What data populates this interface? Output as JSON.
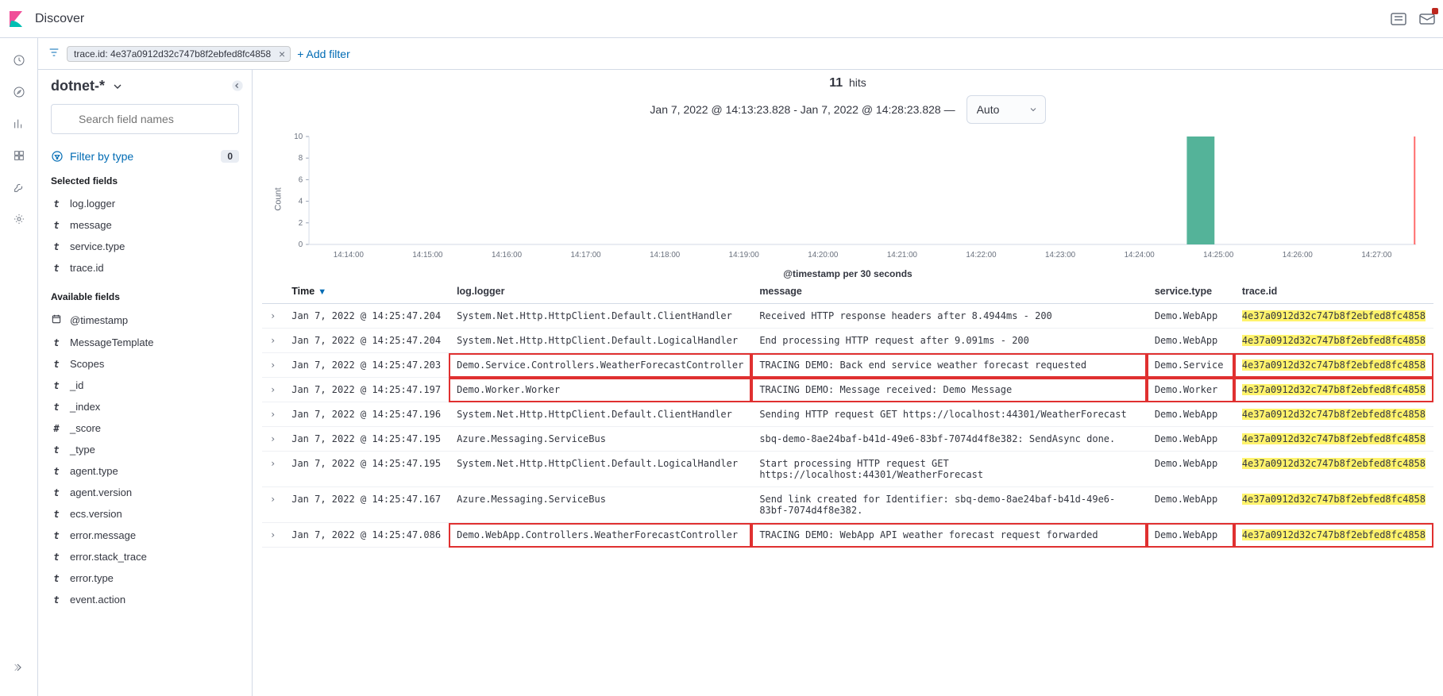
{
  "header": {
    "title": "Discover"
  },
  "filter_bar": {
    "pill": "trace.id: 4e37a0912d32c747b8f2ebfed8fc4858",
    "add_filter": "+ Add filter"
  },
  "side": {
    "index_pattern": "dotnet-*",
    "search_placeholder": "Search field names",
    "filter_by_type": "Filter by type",
    "filter_count": "0",
    "selected_label": "Selected fields",
    "available_label": "Available fields",
    "selected_fields": [
      {
        "type": "t",
        "name": "log.logger"
      },
      {
        "type": "t",
        "name": "message"
      },
      {
        "type": "t",
        "name": "service.type"
      },
      {
        "type": "t",
        "name": "trace.id"
      }
    ],
    "available_fields": [
      {
        "type": "date",
        "name": "@timestamp"
      },
      {
        "type": "t",
        "name": "MessageTemplate"
      },
      {
        "type": "t",
        "name": "Scopes"
      },
      {
        "type": "t",
        "name": "_id"
      },
      {
        "type": "t",
        "name": "_index"
      },
      {
        "type": "num",
        "name": "_score"
      },
      {
        "type": "t",
        "name": "_type"
      },
      {
        "type": "t",
        "name": "agent.type"
      },
      {
        "type": "t",
        "name": "agent.version"
      },
      {
        "type": "t",
        "name": "ecs.version"
      },
      {
        "type": "t",
        "name": "error.message"
      },
      {
        "type": "t",
        "name": "error.stack_trace"
      },
      {
        "type": "t",
        "name": "error.type"
      },
      {
        "type": "t",
        "name": "event.action"
      }
    ]
  },
  "hits": {
    "count": "11",
    "label": "hits",
    "range": "Jan 7, 2022 @ 14:13:23.828 - Jan 7, 2022 @ 14:28:23.828 —",
    "interval": "Auto",
    "x_caption": "@timestamp per 30 seconds"
  },
  "chart_data": {
    "type": "bar",
    "categories": [
      "14:14:00",
      "14:15:00",
      "14:16:00",
      "14:17:00",
      "14:18:00",
      "14:19:00",
      "14:20:00",
      "14:21:00",
      "14:22:00",
      "14:23:00",
      "14:24:00",
      "14:25:00",
      "14:26:00",
      "14:27:00"
    ],
    "values": [
      0,
      0,
      0,
      0,
      0,
      0,
      0,
      0,
      0,
      0,
      0,
      11,
      0,
      0,
      0
    ],
    "ylabel": "Count",
    "ylim": [
      0,
      10
    ],
    "yticks": [
      0,
      2,
      4,
      6,
      8,
      10
    ]
  },
  "table": {
    "columns": {
      "time": "Time",
      "logger": "log.logger",
      "message": "message",
      "service": "service.type",
      "trace": "trace.id"
    },
    "trace_id": "4e37a0912d32c747b8f2ebfed8fc4858",
    "rows": [
      {
        "time": "Jan 7, 2022 @ 14:25:47.204",
        "logger": "System.Net.Http.HttpClient.Default.ClientHandler",
        "message": "Received HTTP response headers after 8.4944ms - 200",
        "service": "Demo.WebApp",
        "hl": false
      },
      {
        "time": "Jan 7, 2022 @ 14:25:47.204",
        "logger": "System.Net.Http.HttpClient.Default.LogicalHandler",
        "message": "End processing HTTP request after 9.091ms - 200",
        "service": "Demo.WebApp",
        "hl": false
      },
      {
        "time": "Jan 7, 2022 @ 14:25:47.203",
        "logger": "Demo.Service.Controllers.WeatherForecastController",
        "message": "TRACING DEMO: Back end service weather forecast requested",
        "service": "Demo.Service",
        "hl": true
      },
      {
        "time": "Jan 7, 2022 @ 14:25:47.197",
        "logger": "Demo.Worker.Worker",
        "message": "TRACING DEMO: Message received: Demo Message",
        "service": "Demo.Worker",
        "hl": true
      },
      {
        "time": "Jan 7, 2022 @ 14:25:47.196",
        "logger": "System.Net.Http.HttpClient.Default.ClientHandler",
        "message": "Sending HTTP request GET https://localhost:44301/WeatherForecast",
        "service": "Demo.WebApp",
        "hl": false
      },
      {
        "time": "Jan 7, 2022 @ 14:25:47.195",
        "logger": "Azure.Messaging.ServiceBus",
        "message": "sbq-demo-8ae24baf-b41d-49e6-83bf-7074d4f8e382: SendAsync done.",
        "service": "Demo.WebApp",
        "hl": false
      },
      {
        "time": "Jan 7, 2022 @ 14:25:47.195",
        "logger": "System.Net.Http.HttpClient.Default.LogicalHandler",
        "message": "Start processing HTTP request GET https://localhost:44301/WeatherForecast",
        "service": "Demo.WebApp",
        "hl": false
      },
      {
        "time": "Jan 7, 2022 @ 14:25:47.167",
        "logger": "Azure.Messaging.ServiceBus",
        "message": "Send link created for Identifier: sbq-demo-8ae24baf-b41d-49e6-83bf-7074d4f8e382.",
        "service": "Demo.WebApp",
        "hl": false
      },
      {
        "time": "Jan 7, 2022 @ 14:25:47.086",
        "logger": "Demo.WebApp.Controllers.WeatherForecastController",
        "message": "TRACING DEMO: WebApp API weather forecast request forwarded",
        "service": "Demo.WebApp",
        "hl": true
      }
    ]
  }
}
